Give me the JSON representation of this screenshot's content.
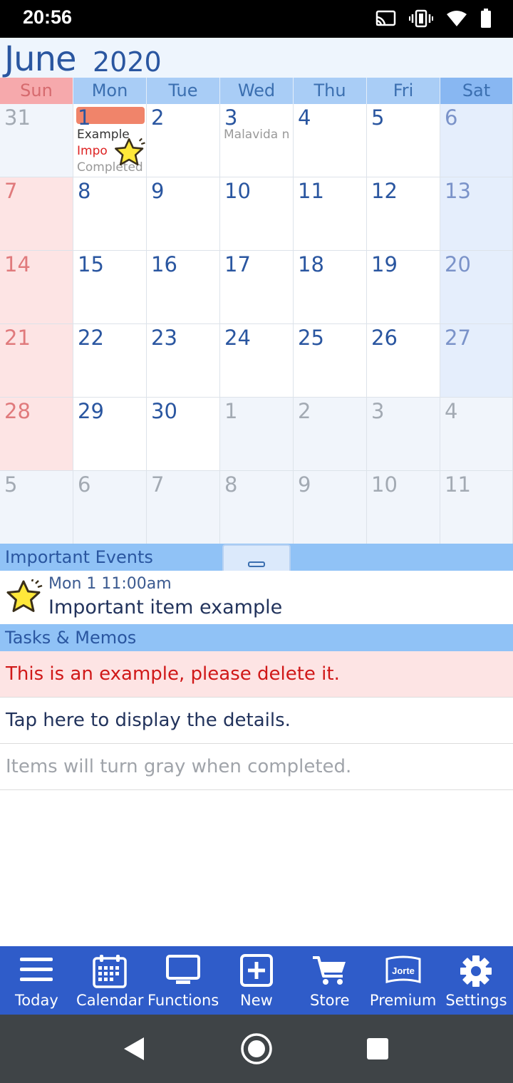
{
  "status_bar": {
    "time": "20:56"
  },
  "header": {
    "month": "June",
    "year": "2020"
  },
  "weekdays": [
    "Sun",
    "Mon",
    "Tue",
    "Wed",
    "Thu",
    "Fri",
    "Sat"
  ],
  "weeks": [
    [
      {
        "d": "31",
        "t": "other"
      },
      {
        "d": "1",
        "t": "today"
      },
      {
        "d": "2"
      },
      {
        "d": "3"
      },
      {
        "d": "4"
      },
      {
        "d": "5"
      },
      {
        "d": "6",
        "t": "sat"
      }
    ],
    [
      {
        "d": "7",
        "t": "sun"
      },
      {
        "d": "8"
      },
      {
        "d": "9"
      },
      {
        "d": "10"
      },
      {
        "d": "11"
      },
      {
        "d": "12"
      },
      {
        "d": "13",
        "t": "sat"
      }
    ],
    [
      {
        "d": "14",
        "t": "sun"
      },
      {
        "d": "15"
      },
      {
        "d": "16"
      },
      {
        "d": "17"
      },
      {
        "d": "18"
      },
      {
        "d": "19"
      },
      {
        "d": "20",
        "t": "sat"
      }
    ],
    [
      {
        "d": "21",
        "t": "sun"
      },
      {
        "d": "22"
      },
      {
        "d": "23"
      },
      {
        "d": "24"
      },
      {
        "d": "25"
      },
      {
        "d": "26"
      },
      {
        "d": "27",
        "t": "sat"
      }
    ],
    [
      {
        "d": "28",
        "t": "sun"
      },
      {
        "d": "29"
      },
      {
        "d": "30"
      },
      {
        "d": "1",
        "t": "other"
      },
      {
        "d": "2",
        "t": "other"
      },
      {
        "d": "3",
        "t": "other"
      },
      {
        "d": "4",
        "t": "other"
      }
    ],
    [
      {
        "d": "5",
        "t": "other"
      },
      {
        "d": "6",
        "t": "other"
      },
      {
        "d": "7",
        "t": "other"
      },
      {
        "d": "8",
        "t": "other"
      },
      {
        "d": "9",
        "t": "other"
      },
      {
        "d": "10",
        "t": "other"
      },
      {
        "d": "11",
        "t": "other"
      }
    ]
  ],
  "day_events": {
    "mon1": [
      "Example",
      "Impo",
      "Completed"
    ],
    "wed3": [
      "Malavida n"
    ]
  },
  "important_events": {
    "heading": "Important Events",
    "item": {
      "date": "Mon 1 11:00am",
      "title": "Important item example"
    }
  },
  "tasks": {
    "heading": "Tasks & Memos",
    "items": [
      {
        "text": "This is an example, please delete it.",
        "style": "red"
      },
      {
        "text": "Tap here to display the details.",
        "style": "normal"
      },
      {
        "text": "Items will turn gray when completed.",
        "style": "gray"
      }
    ]
  },
  "bottom_nav": [
    {
      "label": "Today",
      "icon": "menu-icon"
    },
    {
      "label": "Calendar",
      "icon": "calendar-icon"
    },
    {
      "label": "Functions",
      "icon": "monitor-icon"
    },
    {
      "label": "New",
      "icon": "plus-square-icon"
    },
    {
      "label": "Store",
      "icon": "cart-icon"
    },
    {
      "label": "Premium",
      "icon": "jorte-book-icon"
    },
    {
      "label": "Settings",
      "icon": "gear-icon"
    }
  ],
  "jorte_logo_text": "Jorte",
  "colors": {
    "accent": "#2f5cc9",
    "header_text": "#2a56a0",
    "sunday": "#e07a7c",
    "today_bar": "#f0846a",
    "red_task_bg": "#fde4e4",
    "red_task_text": "#d01818"
  }
}
